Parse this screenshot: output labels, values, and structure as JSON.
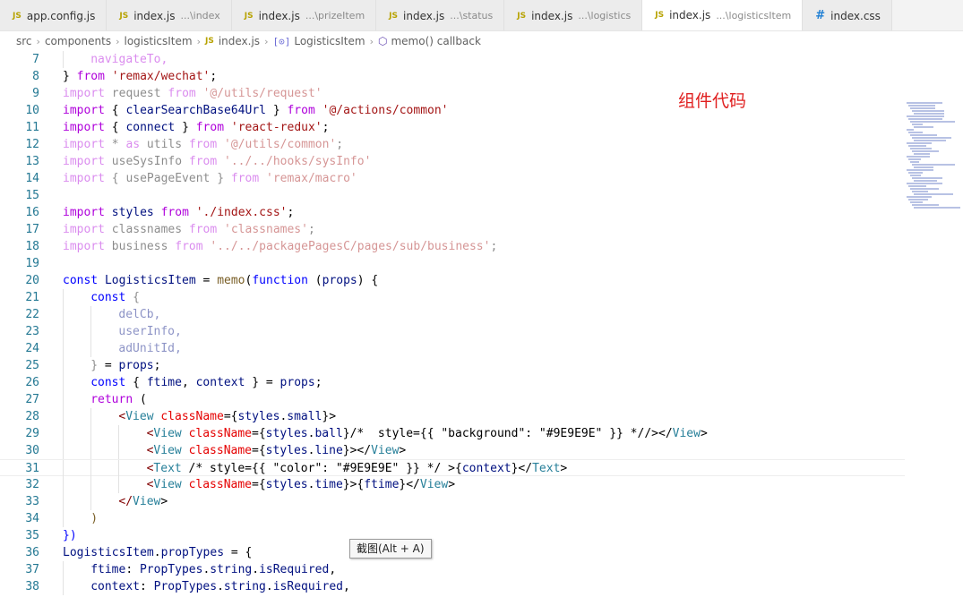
{
  "tabs": [
    {
      "icon": "JS",
      "name": "app.config.js",
      "hint": "",
      "active": false
    },
    {
      "icon": "JS",
      "name": "index.js",
      "hint": "...\\index",
      "active": false
    },
    {
      "icon": "JS",
      "name": "index.js",
      "hint": "...\\prizeItem",
      "active": false
    },
    {
      "icon": "JS",
      "name": "index.js",
      "hint": "...\\status",
      "active": false
    },
    {
      "icon": "JS",
      "name": "index.js",
      "hint": "...\\logistics",
      "active": false
    },
    {
      "icon": "JS",
      "name": "index.js",
      "hint": "...\\logisticsItem",
      "active": true
    },
    {
      "icon": "#",
      "name": "index.css",
      "hint": "",
      "active": false
    }
  ],
  "breadcrumb": {
    "items": [
      "src",
      "components",
      "logisticsItem"
    ],
    "file_icon": "JS",
    "file": "index.js",
    "component": "LogisticsItem",
    "callback": "memo() callback"
  },
  "annotation": "组件代码",
  "tooltip": "截图(Alt + A)",
  "current_line": 31,
  "lines": [
    {
      "n": "7",
      "indent": 1,
      "segs": [
        [
          "navigateTo,",
          "kw2 dim"
        ]
      ]
    },
    {
      "n": "8",
      "indent": 0,
      "segs": [
        [
          "} ",
          ""
        ],
        [
          "from",
          "kw2"
        ],
        [
          " ",
          ""
        ],
        [
          "'remax/wechat'",
          "str"
        ],
        [
          ";",
          ""
        ]
      ]
    },
    {
      "n": "9",
      "indent": 0,
      "segs": [
        [
          "import",
          "kw2 dim"
        ],
        [
          " request ",
          "dim"
        ],
        [
          "from",
          "kw2 dim"
        ],
        [
          " ",
          ""
        ],
        [
          "'@/utils/request'",
          "str dim"
        ]
      ]
    },
    {
      "n": "10",
      "indent": 0,
      "segs": [
        [
          "import",
          "kw2"
        ],
        [
          " { ",
          ""
        ],
        [
          "clearSearchBase64Url",
          "var"
        ],
        [
          " } ",
          ""
        ],
        [
          "from",
          "kw2"
        ],
        [
          " ",
          ""
        ],
        [
          "'@/actions/common'",
          "str"
        ]
      ]
    },
    {
      "n": "11",
      "indent": 0,
      "segs": [
        [
          "import",
          "kw2"
        ],
        [
          " { ",
          ""
        ],
        [
          "connect",
          "var"
        ],
        [
          " } ",
          ""
        ],
        [
          "from",
          "kw2"
        ],
        [
          " ",
          ""
        ],
        [
          "'react-redux'",
          "str"
        ],
        [
          ";",
          ""
        ]
      ]
    },
    {
      "n": "12",
      "indent": 0,
      "segs": [
        [
          "import",
          "kw2 dim"
        ],
        [
          " * ",
          "dim"
        ],
        [
          "as",
          "kw2 dim"
        ],
        [
          " utils ",
          "dim"
        ],
        [
          "from",
          "kw2 dim"
        ],
        [
          " ",
          ""
        ],
        [
          "'@/utils/common'",
          "str dim"
        ],
        [
          ";",
          "dim"
        ]
      ]
    },
    {
      "n": "13",
      "indent": 0,
      "segs": [
        [
          "import",
          "kw2 dim"
        ],
        [
          " useSysInfo ",
          "dim"
        ],
        [
          "from",
          "kw2 dim"
        ],
        [
          " ",
          ""
        ],
        [
          "'../../hooks/sysInfo'",
          "str dim"
        ]
      ]
    },
    {
      "n": "14",
      "indent": 0,
      "segs": [
        [
          "import",
          "kw2 dim"
        ],
        [
          " { usePageEvent } ",
          "dim"
        ],
        [
          "from",
          "kw2 dim"
        ],
        [
          " ",
          ""
        ],
        [
          "'remax/macro'",
          "str dim"
        ]
      ]
    },
    {
      "n": "15",
      "indent": 0,
      "segs": []
    },
    {
      "n": "16",
      "indent": 0,
      "segs": [
        [
          "import",
          "kw2"
        ],
        [
          " ",
          ""
        ],
        [
          "styles",
          "var"
        ],
        [
          " ",
          ""
        ],
        [
          "from",
          "kw2"
        ],
        [
          " ",
          ""
        ],
        [
          "'./index.css'",
          "str"
        ],
        [
          ";",
          ""
        ]
      ]
    },
    {
      "n": "17",
      "indent": 0,
      "segs": [
        [
          "import",
          "kw2 dim"
        ],
        [
          " classnames ",
          "dim"
        ],
        [
          "from",
          "kw2 dim"
        ],
        [
          " ",
          ""
        ],
        [
          "'classnames'",
          "str dim"
        ],
        [
          ";",
          "dim"
        ]
      ]
    },
    {
      "n": "18",
      "indent": 0,
      "segs": [
        [
          "import",
          "kw2 dim"
        ],
        [
          " business ",
          "dim"
        ],
        [
          "from",
          "kw2 dim"
        ],
        [
          " ",
          ""
        ],
        [
          "'../../packagePagesC/pages/sub/business'",
          "str dim"
        ],
        [
          ";",
          "dim"
        ]
      ]
    },
    {
      "n": "19",
      "indent": 0,
      "segs": []
    },
    {
      "n": "20",
      "indent": 0,
      "segs": [
        [
          "const",
          "kw"
        ],
        [
          " ",
          ""
        ],
        [
          "LogisticsItem",
          "var"
        ],
        [
          " = ",
          ""
        ],
        [
          "memo",
          "fn"
        ],
        [
          "(",
          ""
        ],
        [
          "function",
          "kw"
        ],
        [
          " (",
          ""
        ],
        [
          "props",
          "var"
        ],
        [
          ") {",
          ""
        ]
      ]
    },
    {
      "n": "21",
      "indent": 1,
      "segs": [
        [
          "const",
          "kw"
        ],
        [
          " {",
          "dim"
        ]
      ]
    },
    {
      "n": "22",
      "indent": 2,
      "segs": [
        [
          "delCb,",
          "var dim"
        ]
      ]
    },
    {
      "n": "23",
      "indent": 2,
      "segs": [
        [
          "userInfo,",
          "var dim"
        ]
      ]
    },
    {
      "n": "24",
      "indent": 2,
      "segs": [
        [
          "adUnitId,",
          "var dim"
        ]
      ]
    },
    {
      "n": "25",
      "indent": 1,
      "segs": [
        [
          "}",
          "dim"
        ],
        [
          " = ",
          ""
        ],
        [
          "props",
          "var"
        ],
        [
          ";",
          ""
        ]
      ]
    },
    {
      "n": "26",
      "indent": 1,
      "segs": [
        [
          "const",
          "kw"
        ],
        [
          " { ",
          ""
        ],
        [
          "ftime",
          "var"
        ],
        [
          ", ",
          ""
        ],
        [
          "context",
          "var"
        ],
        [
          " } = ",
          ""
        ],
        [
          "props",
          "var"
        ],
        [
          ";",
          ""
        ]
      ]
    },
    {
      "n": "27",
      "indent": 1,
      "segs": [
        [
          "return",
          "kw2"
        ],
        [
          " (",
          ""
        ]
      ]
    },
    {
      "n": "28",
      "indent": 2,
      "segs": [
        [
          "<",
          "tag"
        ],
        [
          "View",
          "jsx"
        ],
        [
          " ",
          ""
        ],
        [
          "className",
          "prop"
        ],
        [
          "={",
          ""
        ],
        [
          "styles",
          "var"
        ],
        [
          ".",
          ""
        ],
        [
          "small",
          "var"
        ],
        [
          "}>",
          ""
        ]
      ]
    },
    {
      "n": "29",
      "indent": 3,
      "segs": [
        [
          "<",
          "tag"
        ],
        [
          "View",
          "jsx"
        ],
        [
          " ",
          ""
        ],
        [
          "className",
          "prop"
        ],
        [
          "={",
          ""
        ],
        [
          "styles",
          "var"
        ],
        [
          ".",
          ""
        ],
        [
          "ball",
          "var"
        ],
        [
          "}",
          ""
        ],
        [
          "/*  style={{ \"background\": \"#9E9E9E\" }} */",
          ""
        ],
        [
          "/></",
          ""
        ],
        [
          "View",
          "jsx"
        ],
        [
          ">",
          ""
        ]
      ]
    },
    {
      "n": "30",
      "indent": 3,
      "segs": [
        [
          "<",
          "tag"
        ],
        [
          "View",
          "jsx"
        ],
        [
          " ",
          ""
        ],
        [
          "className",
          "prop"
        ],
        [
          "={",
          ""
        ],
        [
          "styles",
          "var"
        ],
        [
          ".",
          ""
        ],
        [
          "line",
          "var"
        ],
        [
          "}></",
          ""
        ],
        [
          "View",
          "jsx"
        ],
        [
          ">",
          ""
        ]
      ]
    },
    {
      "n": "31",
      "indent": 3,
      "segs": [
        [
          "<",
          "tag"
        ],
        [
          "Text",
          "jsx"
        ],
        [
          " /* style={{ \"color\": \"#9E9E9E\" }} */ ",
          ""
        ],
        [
          ">{",
          ""
        ],
        [
          "context",
          "var"
        ],
        [
          "}</",
          ""
        ],
        [
          "Text",
          "jsx"
        ],
        [
          ">",
          ""
        ]
      ]
    },
    {
      "n": "32",
      "indent": 3,
      "segs": [
        [
          "<",
          "tag"
        ],
        [
          "View",
          "jsx"
        ],
        [
          " ",
          ""
        ],
        [
          "className",
          "prop"
        ],
        [
          "={",
          ""
        ],
        [
          "styles",
          "var"
        ],
        [
          ".",
          ""
        ],
        [
          "time",
          "var"
        ],
        [
          "}>{",
          ""
        ],
        [
          "ftime",
          "var"
        ],
        [
          "}</",
          ""
        ],
        [
          "View",
          "jsx"
        ],
        [
          ">",
          ""
        ]
      ]
    },
    {
      "n": "33",
      "indent": 2,
      "segs": [
        [
          "</",
          "tag"
        ],
        [
          "View",
          "jsx"
        ],
        [
          ">",
          ""
        ]
      ]
    },
    {
      "n": "34",
      "indent": 1,
      "segs": [
        [
          ")",
          "fn"
        ]
      ]
    },
    {
      "n": "35",
      "indent": 0,
      "segs": [
        [
          "})",
          "kw"
        ]
      ]
    },
    {
      "n": "36",
      "indent": 0,
      "segs": [
        [
          "LogisticsItem",
          "var"
        ],
        [
          ".",
          ""
        ],
        [
          "propTypes",
          "var"
        ],
        [
          " = {",
          ""
        ]
      ]
    },
    {
      "n": "37",
      "indent": 1,
      "segs": [
        [
          "ftime",
          "var"
        ],
        [
          ": ",
          ""
        ],
        [
          "PropTypes",
          "var"
        ],
        [
          ".",
          ""
        ],
        [
          "string",
          "var"
        ],
        [
          ".",
          ""
        ],
        [
          "isRequired",
          "var"
        ],
        [
          ",",
          ""
        ]
      ]
    },
    {
      "n": "38",
      "indent": 1,
      "segs": [
        [
          "context",
          "var"
        ],
        [
          ": ",
          ""
        ],
        [
          "PropTypes",
          "var"
        ],
        [
          ".",
          ""
        ],
        [
          "string",
          "var"
        ],
        [
          ".",
          ""
        ],
        [
          "isRequired",
          "var"
        ],
        [
          ",",
          ""
        ]
      ]
    }
  ]
}
